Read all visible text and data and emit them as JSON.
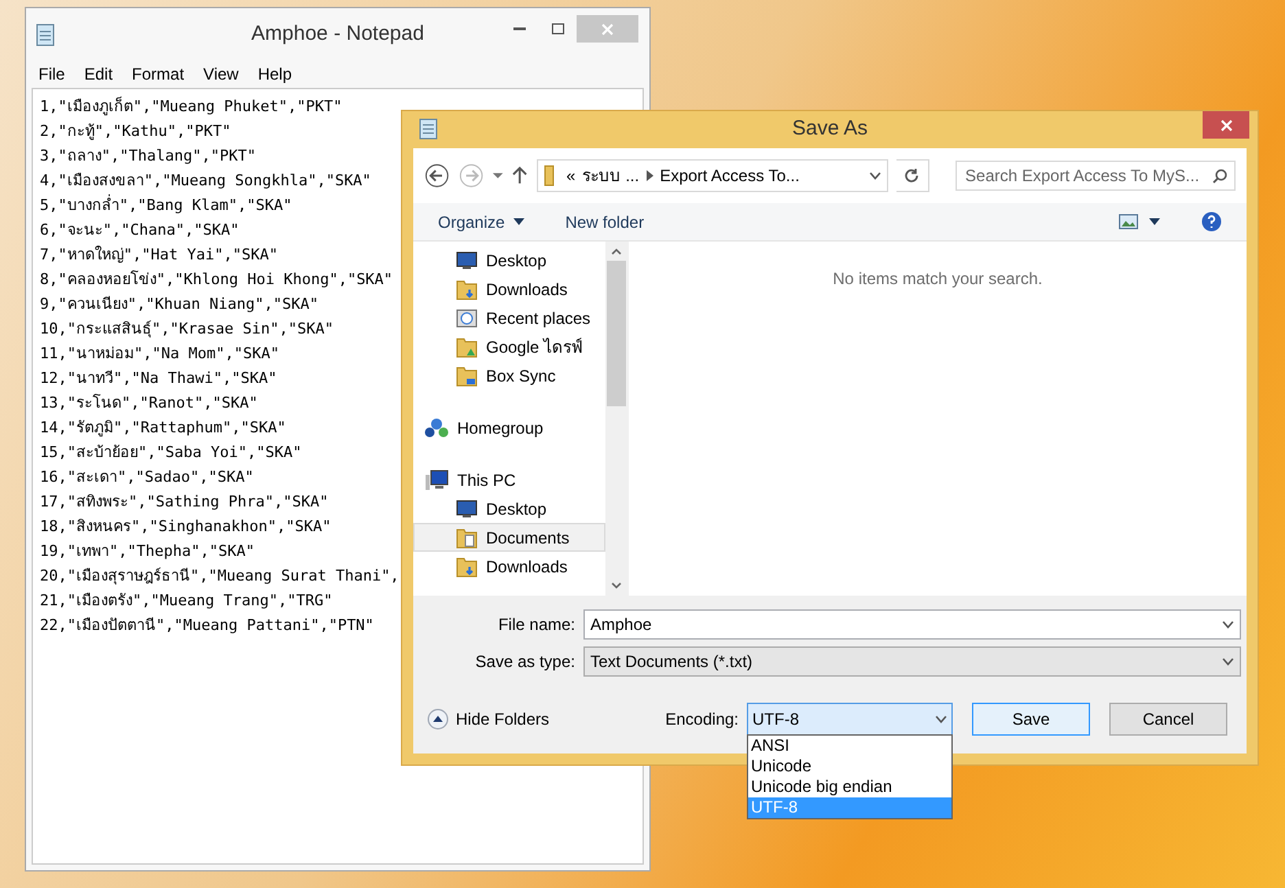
{
  "notepad": {
    "title": "Amphoe - Notepad",
    "menu": [
      "File",
      "Edit",
      "Format",
      "View",
      "Help"
    ],
    "lines": [
      "1,\"เมืองภูเก็ต\",\"Mueang Phuket\",\"PKT\"",
      "2,\"กะทู้\",\"Kathu\",\"PKT\"",
      "3,\"ถลาง\",\"Thalang\",\"PKT\"",
      "4,\"เมืองสงขลา\",\"Mueang Songkhla\",\"SKA\"",
      "5,\"บางกล่ำ\",\"Bang Klam\",\"SKA\"",
      "6,\"จะนะ\",\"Chana\",\"SKA\"",
      "7,\"หาดใหญ่\",\"Hat Yai\",\"SKA\"",
      "8,\"คลองหอยโข่ง\",\"Khlong Hoi Khong\",\"SKA\"",
      "9,\"ควนเนียง\",\"Khuan Niang\",\"SKA\"",
      "10,\"กระแสสินธุ์\",\"Krasae Sin\",\"SKA\"",
      "11,\"นาหม่อม\",\"Na Mom\",\"SKA\"",
      "12,\"นาทวี\",\"Na Thawi\",\"SKA\"",
      "13,\"ระโนด\",\"Ranot\",\"SKA\"",
      "14,\"รัตภูมิ\",\"Rattaphum\",\"SKA\"",
      "15,\"สะบ้าย้อย\",\"Saba Yoi\",\"SKA\"",
      "16,\"สะเดา\",\"Sadao\",\"SKA\"",
      "17,\"สทิงพระ\",\"Sathing Phra\",\"SKA\"",
      "18,\"สิงหนคร\",\"Singhanakhon\",\"SKA\"",
      "19,\"เทพา\",\"Thepha\",\"SKA\"",
      "20,\"เมืองสุราษฎร์ธานี\",\"Mueang Surat Thani\",",
      "21,\"เมืองตรัง\",\"Mueang Trang\",\"TRG\"",
      "22,\"เมืองปัตตานี\",\"Mueang Pattani\",\"PTN\""
    ]
  },
  "save_dialog": {
    "title": "Save As",
    "address": {
      "prefix": "«",
      "parts": [
        "ระบบ ...",
        "Export Access To..."
      ]
    },
    "search": {
      "placeholder": "Search Export Access To MyS..."
    },
    "toolbar": {
      "organize": "Organize",
      "new_folder": "New folder"
    },
    "nav": [
      {
        "label": "Desktop",
        "kind": "desktop",
        "selected": false
      },
      {
        "label": "Downloads",
        "kind": "downloads",
        "selected": false
      },
      {
        "label": "Recent places",
        "kind": "recent",
        "selected": false
      },
      {
        "label": "Google ไดรฟ์",
        "kind": "drive",
        "selected": false
      },
      {
        "label": "Box Sync",
        "kind": "box",
        "selected": false
      },
      {
        "label": "Homegroup",
        "kind": "homegroup",
        "selected": false
      },
      {
        "label": "This PC",
        "kind": "pc",
        "selected": false,
        "children": [
          {
            "label": "Desktop",
            "kind": "desktop",
            "selected": false
          },
          {
            "label": "Documents",
            "kind": "documents",
            "selected": true
          },
          {
            "label": "Downloads",
            "kind": "downloads",
            "selected": false
          }
        ]
      }
    ],
    "empty_message": "No items match your search.",
    "file_name": {
      "label": "File name:",
      "value": "Amphoe"
    },
    "save_as_type": {
      "label": "Save as type:",
      "value": "Text Documents (*.txt)"
    },
    "hide_folders": "Hide Folders",
    "encoding": {
      "label": "Encoding:",
      "value": "UTF-8",
      "expanded": true,
      "options": [
        {
          "label": "ANSI",
          "selected": false
        },
        {
          "label": "Unicode",
          "selected": false
        },
        {
          "label": "Unicode big endian",
          "selected": false
        },
        {
          "label": "UTF-8",
          "selected": true
        }
      ]
    },
    "buttons": [
      {
        "label": "Save",
        "default": true
      },
      {
        "label": "Cancel",
        "default": false
      }
    ]
  }
}
